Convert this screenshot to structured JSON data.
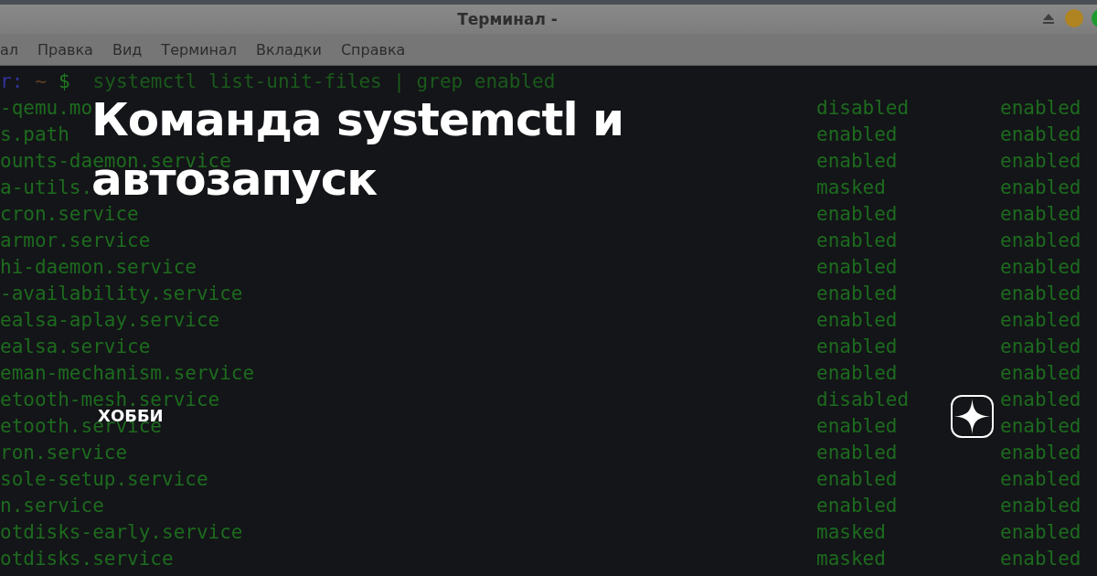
{
  "window": {
    "title": "Терминал -",
    "controls": [
      {
        "kind": "eject"
      },
      {
        "kind": "dot",
        "color": "#b08420"
      },
      {
        "kind": "dot",
        "color": "#1c9a2c"
      }
    ]
  },
  "menu": [
    "ал",
    "Правка",
    "Вид",
    "Терминал",
    "Вкладки",
    "Справка"
  ],
  "prompt": {
    "user": "r:",
    "path": "~",
    "symbol": "$",
    "command": "systemctl list-unit-files | grep enabled"
  },
  "rows": [
    {
      "unit": "-qemu.mo",
      "state": "disabled",
      "preset": "enabled"
    },
    {
      "unit": "s.path",
      "state": "enabled",
      "preset": "enabled"
    },
    {
      "unit": "ounts-daemon.service",
      "state": "enabled",
      "preset": "enabled"
    },
    {
      "unit": "a-utils.",
      "state": "masked",
      "preset": "enabled"
    },
    {
      "unit": "cron.service",
      "state": "enabled",
      "preset": "enabled"
    },
    {
      "unit": "armor.service",
      "state": "enabled",
      "preset": "enabled"
    },
    {
      "unit": "hi-daemon.service",
      "state": "enabled",
      "preset": "enabled"
    },
    {
      "unit": "-availability.service",
      "state": "enabled",
      "preset": "enabled"
    },
    {
      "unit": "ealsa-aplay.service",
      "state": "enabled",
      "preset": "enabled"
    },
    {
      "unit": "ealsa.service",
      "state": "enabled",
      "preset": "enabled"
    },
    {
      "unit": "eman-mechanism.service",
      "state": "enabled",
      "preset": "enabled"
    },
    {
      "unit": "etooth-mesh.service",
      "state": "disabled",
      "preset": "enabled"
    },
    {
      "unit": "etooth.service",
      "state": "enabled",
      "preset": "enabled"
    },
    {
      "unit": "ron.service",
      "state": "enabled",
      "preset": "enabled"
    },
    {
      "unit": "sole-setup.service",
      "state": "enabled",
      "preset": "enabled"
    },
    {
      "unit": "n.service",
      "state": "enabled",
      "preset": "enabled"
    },
    {
      "unit": "otdisks-early.service",
      "state": "masked",
      "preset": "enabled"
    },
    {
      "unit": "otdisks.service",
      "state": "masked",
      "preset": "enabled"
    }
  ],
  "article": {
    "title_lines": [
      "Команда systemctl и",
      "автозапуск"
    ],
    "category": "ХОББИ"
  }
}
